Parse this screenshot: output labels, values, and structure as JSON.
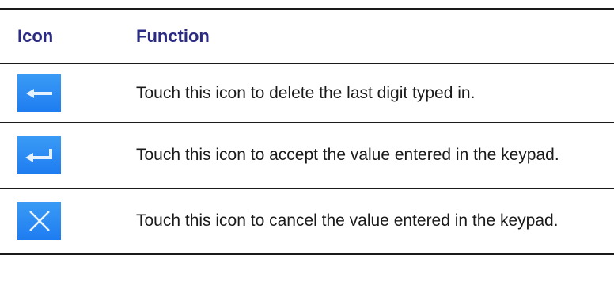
{
  "table": {
    "header": {
      "icon_col": "Icon",
      "function_col": "Function"
    },
    "rows": [
      {
        "icon": "backspace-arrow-icon",
        "text": "Touch this icon to delete the last digit typed in."
      },
      {
        "icon": "enter-return-icon",
        "text": "Touch this icon to accept the value entered in the keypad."
      },
      {
        "icon": "cancel-x-icon",
        "text": "Touch this icon to cancel the value entered in the keypad."
      }
    ]
  },
  "colors": {
    "header_text": "#2b2b83",
    "icon_tile": "#1e7cf0",
    "rule": "#1a1a1a"
  }
}
